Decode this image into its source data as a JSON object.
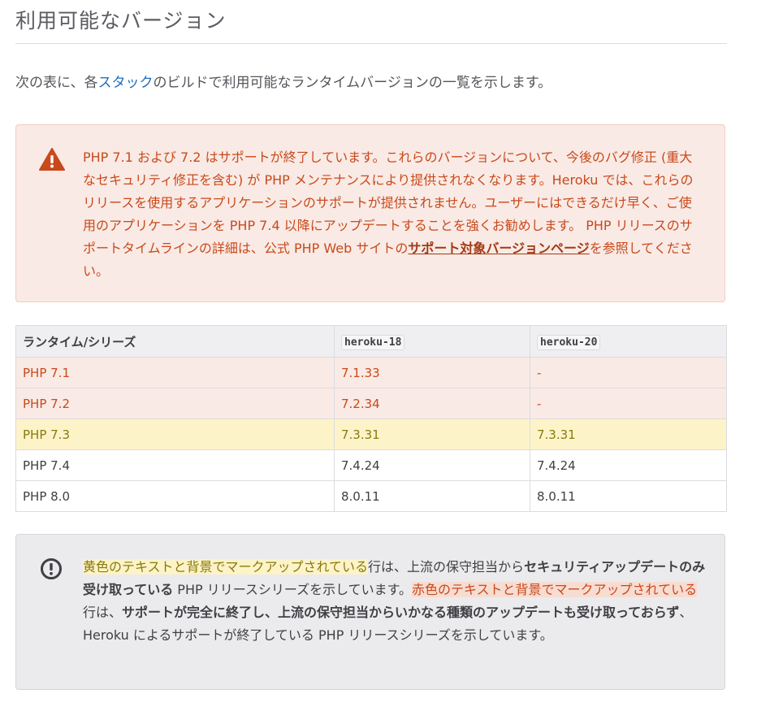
{
  "heading": "利用可能なバージョン",
  "intro": {
    "before": "次の表に、各",
    "link": "スタック",
    "after": "のビルドで利用可能なランタイムバージョンの一覧を示します。"
  },
  "warning": {
    "icon": "warning-triangle-icon",
    "text": "PHP 7.1 および 7.2 はサポートが終了しています。これらのバージョンについて、今後のバグ修正 (重大なセキュリティ修正を含む) が PHP メンテナンスにより提供されなくなります。Heroku では、これらのリリースを使用するアプリケーションのサポートが提供されません。ユーザーにはできるだけ早く、ご使用のアプリケーションを PHP 7.4 以降にアップデートすることを強くお勧めします。 PHP リリースのサポートタイムラインの詳細は、公式 PHP Web サイトの",
    "link": "サポート対象バージョンページ",
    "suffix": "を参照してください。"
  },
  "table": {
    "headers": [
      "ランタイム/シリーズ",
      "heroku-18",
      "heroku-20"
    ],
    "rows": [
      {
        "runtime": "PHP 7.1",
        "heroku18": "7.1.33",
        "heroku20": "-"
      },
      {
        "runtime": "PHP 7.2",
        "heroku18": "7.2.34",
        "heroku20": "-"
      },
      {
        "runtime": "PHP 7.3",
        "heroku18": "7.3.31",
        "heroku20": "7.3.31"
      },
      {
        "runtime": "PHP 7.4",
        "heroku18": "7.4.24",
        "heroku20": "7.4.24"
      },
      {
        "runtime": "PHP 8.0",
        "heroku18": "8.0.11",
        "heroku20": "8.0.11"
      }
    ]
  },
  "info": {
    "icon": "exclamation-circle-icon",
    "yellow_marked": "黄色のテキストと背景でマークアップされている",
    "part1": "行は、上流の保守担当から",
    "bold1": "セキュリティアップデートのみ受け取っている",
    "part2": " PHP リリースシリーズを示しています。",
    "red_marked": "赤色のテキストと背景でマークアップされている",
    "part3": "行は、",
    "bold2": "サポートが完全に終了し、上流の保守担当からいかなる種類のアップデートも受け取っておらず",
    "part4": "、Heroku によるサポートが終了している PHP リリースシリーズを示しています。"
  },
  "colors": {
    "link": "#1f6fbd",
    "eol_text": "#c9491b",
    "eol_background": "#f9eae5",
    "security_text": "#8a7a0c",
    "security_background": "#fdf3c8"
  }
}
